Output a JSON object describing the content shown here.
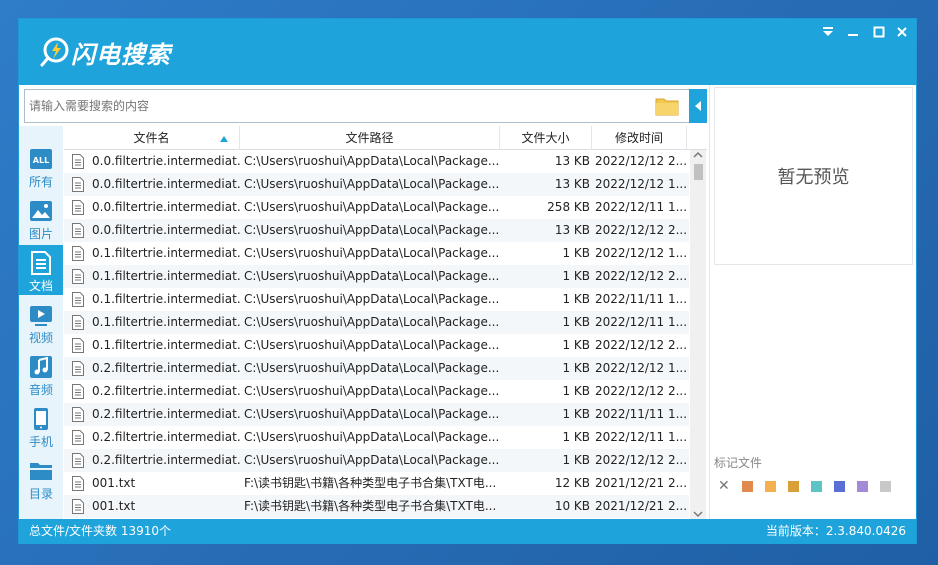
{
  "app": {
    "title": "闪电搜索"
  },
  "search": {
    "placeholder": "请输入需要搜索的内容",
    "value": ""
  },
  "nav": [
    {
      "label": "所有",
      "icon": "all-icon"
    },
    {
      "label": "图片",
      "icon": "image-icon"
    },
    {
      "label": "文档",
      "icon": "document-icon"
    },
    {
      "label": "视频",
      "icon": "video-icon"
    },
    {
      "label": "音频",
      "icon": "audio-icon"
    },
    {
      "label": "手机",
      "icon": "phone-icon"
    },
    {
      "label": "目录",
      "icon": "folder-icon"
    }
  ],
  "nav_active": "文档",
  "table": {
    "columns": [
      "文件名",
      "文件路径",
      "文件大小",
      "修改时间"
    ],
    "sort_column": "文件名",
    "rows": [
      {
        "name": "0.0.filtertrie.intermediat...",
        "path": "C:\\Users\\ruoshui\\AppData\\Local\\Package...",
        "size": "13 KB",
        "date": "2022/12/12 2..."
      },
      {
        "name": "0.0.filtertrie.intermediat...",
        "path": "C:\\Users\\ruoshui\\AppData\\Local\\Package...",
        "size": "13 KB",
        "date": "2022/12/12 1..."
      },
      {
        "name": "0.0.filtertrie.intermediat...",
        "path": "C:\\Users\\ruoshui\\AppData\\Local\\Package...",
        "size": "258 KB",
        "date": "2022/12/11 1..."
      },
      {
        "name": "0.0.filtertrie.intermediat...",
        "path": "C:\\Users\\ruoshui\\AppData\\Local\\Package...",
        "size": "13 KB",
        "date": "2022/12/12 2..."
      },
      {
        "name": "0.1.filtertrie.intermediat...",
        "path": "C:\\Users\\ruoshui\\AppData\\Local\\Package...",
        "size": "1 KB",
        "date": "2022/12/12 1..."
      },
      {
        "name": "0.1.filtertrie.intermediat...",
        "path": "C:\\Users\\ruoshui\\AppData\\Local\\Package...",
        "size": "1 KB",
        "date": "2022/12/12 2..."
      },
      {
        "name": "0.1.filtertrie.intermediat...",
        "path": "C:\\Users\\ruoshui\\AppData\\Local\\Package...",
        "size": "1 KB",
        "date": "2022/11/11 1..."
      },
      {
        "name": "0.1.filtertrie.intermediat...",
        "path": "C:\\Users\\ruoshui\\AppData\\Local\\Package...",
        "size": "1 KB",
        "date": "2022/12/11 1..."
      },
      {
        "name": "0.1.filtertrie.intermediat...",
        "path": "C:\\Users\\ruoshui\\AppData\\Local\\Package...",
        "size": "1 KB",
        "date": "2022/12/12 2..."
      },
      {
        "name": "0.2.filtertrie.intermediat...",
        "path": "C:\\Users\\ruoshui\\AppData\\Local\\Package...",
        "size": "1 KB",
        "date": "2022/12/12 1..."
      },
      {
        "name": "0.2.filtertrie.intermediat...",
        "path": "C:\\Users\\ruoshui\\AppData\\Local\\Package...",
        "size": "1 KB",
        "date": "2022/12/12 2..."
      },
      {
        "name": "0.2.filtertrie.intermediat...",
        "path": "C:\\Users\\ruoshui\\AppData\\Local\\Package...",
        "size": "1 KB",
        "date": "2022/11/11 1..."
      },
      {
        "name": "0.2.filtertrie.intermediat...",
        "path": "C:\\Users\\ruoshui\\AppData\\Local\\Package...",
        "size": "1 KB",
        "date": "2022/12/11 1..."
      },
      {
        "name": "0.2.filtertrie.intermediat...",
        "path": "C:\\Users\\ruoshui\\AppData\\Local\\Package...",
        "size": "1 KB",
        "date": "2022/12/12 2..."
      },
      {
        "name": "001.txt",
        "path": "F:\\读书钥匙\\书籍\\各种类型电子书合集\\TXT电...",
        "size": "12 KB",
        "date": "2021/12/21 2..."
      },
      {
        "name": "001.txt",
        "path": "F:\\读书钥匙\\书籍\\各种类型电子书合集\\TXT电...",
        "size": "10 KB",
        "date": "2021/12/21 2..."
      }
    ]
  },
  "preview": {
    "empty_text": "暂无预览"
  },
  "marks": {
    "label": "标记文件",
    "colors": [
      "#e08a4e",
      "#f4b04e",
      "#d9a03a",
      "#5cc4c4",
      "#5b6ed6",
      "#a28ad6",
      "#c8c8c8"
    ]
  },
  "status": {
    "left": "总文件/文件夹数 13910个",
    "right": "当前版本：2.3.840.0426"
  },
  "colors": {
    "accent": "#1fa3db"
  }
}
